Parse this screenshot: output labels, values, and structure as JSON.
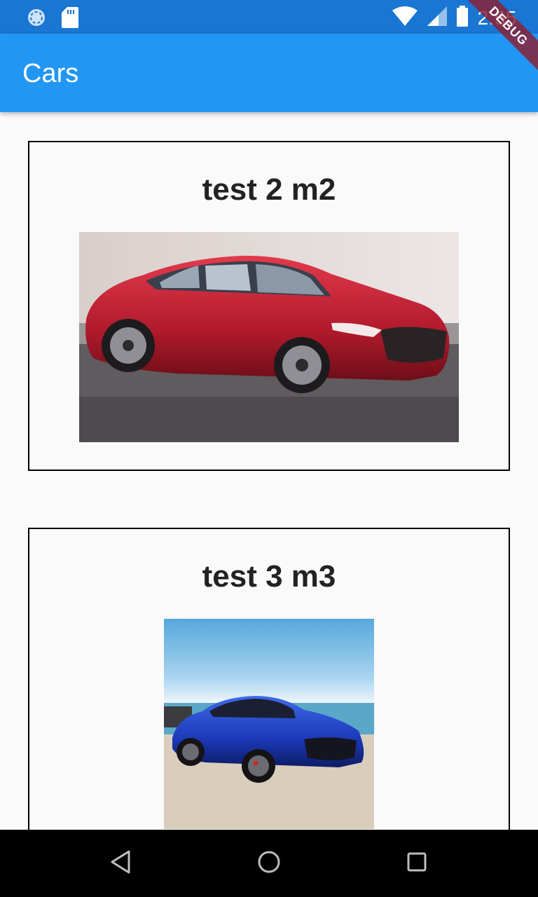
{
  "status_bar": {
    "time": "2:55",
    "icons": [
      "sync-icon",
      "sd-card-icon",
      "wifi-icon",
      "signal-icon",
      "battery-icon"
    ]
  },
  "debug_banner": "DEBUG",
  "app_bar": {
    "title": "Cars"
  },
  "cars": [
    {
      "title": "test 2 m2",
      "image": "red sedan photo"
    },
    {
      "title": "test 3 m3",
      "image": "blue sedan photo"
    }
  ],
  "nav_bar": {
    "icons": [
      "back-icon",
      "home-icon",
      "recents-icon"
    ]
  },
  "colors": {
    "status_bar": "#1976d2",
    "app_bar": "#2196f3",
    "background": "#fafafa"
  }
}
